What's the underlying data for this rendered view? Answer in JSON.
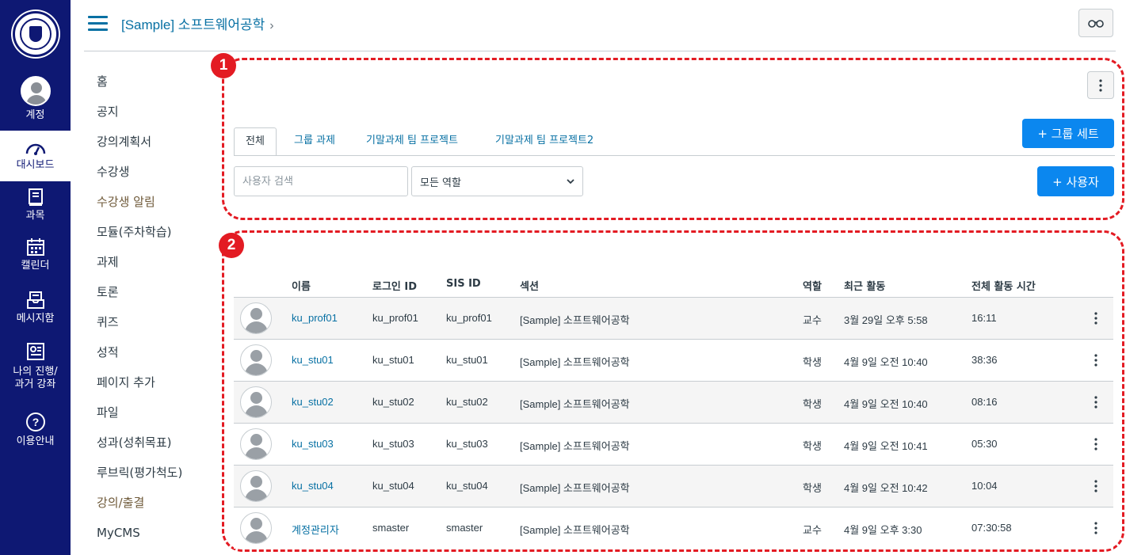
{
  "nav": {
    "account": "계정",
    "dashboard": "대시보드",
    "courses": "과목",
    "calendar": "캘린더",
    "inbox": "메시지함",
    "progress_line1": "나의 진행/",
    "progress_line2": "과거 강좌",
    "help": "이용안내"
  },
  "header": {
    "breadcrumb": "[Sample] 소프트웨어공학",
    "separator": "›"
  },
  "course_nav": [
    {
      "label": "홈"
    },
    {
      "label": "공지"
    },
    {
      "label": "강의계획서"
    },
    {
      "label": "수강생"
    },
    {
      "label": "수강생 알림"
    },
    {
      "label": "모듈(주차학습)"
    },
    {
      "label": "과제"
    },
    {
      "label": "토론"
    },
    {
      "label": "퀴즈"
    },
    {
      "label": "성적"
    },
    {
      "label": "페이지 추가"
    },
    {
      "label": "파일"
    },
    {
      "label": "성과(성취목표)"
    },
    {
      "label": "루브릭(평가척도)"
    },
    {
      "label": "강의/출결"
    },
    {
      "label": "MyCMS"
    }
  ],
  "badges": {
    "one": "1",
    "two": "2"
  },
  "tabs": [
    "전체",
    "그룹 과제",
    "기말과제 팀 프로젝트",
    "기말과제 팀 프로젝트2"
  ],
  "buttons": {
    "group_set": "+ 그룹 세트",
    "add_user": "+ 사용자"
  },
  "search": {
    "placeholder": "사용자 검색"
  },
  "role_filter": {
    "selected": "모든 역할"
  },
  "table": {
    "headers": [
      "이름",
      "로그인 ID",
      "SIS ID",
      "섹션",
      "역할",
      "최근 활동",
      "전체 활동 시간"
    ],
    "rows": [
      {
        "name": "ku_prof01",
        "login": "ku_prof01",
        "sis": "ku_prof01",
        "section": "[Sample] 소프트웨어공학",
        "role": "교수",
        "last": "3월 29일 오후 5:58",
        "total": "16:11"
      },
      {
        "name": "ku_stu01",
        "login": "ku_stu01",
        "sis": "ku_stu01",
        "section": "[Sample] 소프트웨어공학",
        "role": "학생",
        "last": "4월 9일 오전 10:40",
        "total": "38:36"
      },
      {
        "name": "ku_stu02",
        "login": "ku_stu02",
        "sis": "ku_stu02",
        "section": "[Sample] 소프트웨어공학",
        "role": "학생",
        "last": "4월 9일 오전 10:40",
        "total": "08:16"
      },
      {
        "name": "ku_stu03",
        "login": "ku_stu03",
        "sis": "ku_stu03",
        "section": "[Sample] 소프트웨어공학",
        "role": "학생",
        "last": "4월 9일 오전 10:41",
        "total": "05:30"
      },
      {
        "name": "ku_stu04",
        "login": "ku_stu04",
        "sis": "ku_stu04",
        "section": "[Sample] 소프트웨어공학",
        "role": "학생",
        "last": "4월 9일 오전 10:42",
        "total": "10:04"
      },
      {
        "name": "계정관리자",
        "login": "smaster",
        "sis": "smaster",
        "section": "[Sample] 소프트웨어공학",
        "role": "교수",
        "last": "4월 9일 오후 3:30",
        "total": "07:30:58"
      }
    ]
  },
  "colors": {
    "nav_bg": "#0e1873",
    "link": "#0770a3",
    "primary": "#0b87ef",
    "highlight": "#e31b23"
  }
}
